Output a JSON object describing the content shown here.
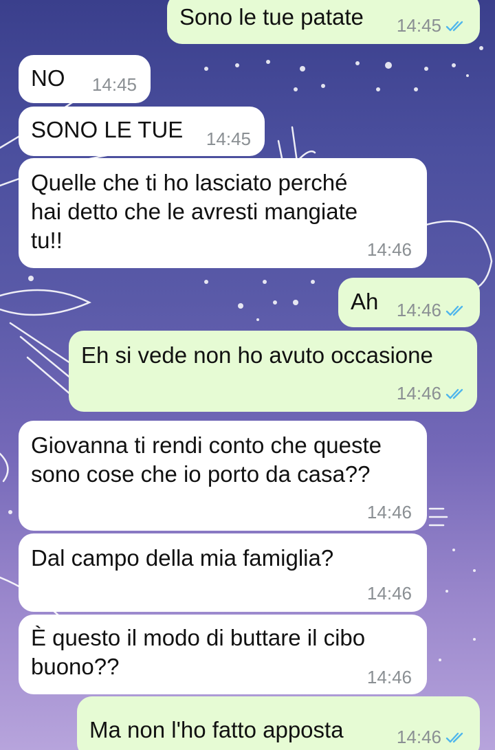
{
  "chat": {
    "messages": [
      {
        "direction": "out",
        "text": "Sono le tue patate",
        "time": "14:45",
        "status": "read"
      },
      {
        "direction": "in",
        "text": "NO",
        "time": "14:45"
      },
      {
        "direction": "in",
        "text": "SONO LE TUE",
        "time": "14:45"
      },
      {
        "direction": "in",
        "text": "Quelle che ti ho lasciato perché\nhai detto che le avresti mangiate\ntu!!",
        "time": "14:46"
      },
      {
        "direction": "out",
        "text": "Ah",
        "time": "14:46",
        "status": "read"
      },
      {
        "direction": "out",
        "text": "Eh si vede non ho avuto occasione",
        "time": "14:46",
        "status": "read"
      },
      {
        "direction": "in",
        "text": "Giovanna ti rendi conto che queste\nsono cose che io porto da casa??",
        "time": "14:46"
      },
      {
        "direction": "in",
        "text": "Dal campo della mia famiglia?",
        "time": "14:46"
      },
      {
        "direction": "in",
        "text": "È questo il modo di buttare il cibo\nbuono??",
        "time": "14:46"
      },
      {
        "direction": "out",
        "text": "Ma non l'ho fatto apposta",
        "time": "14:46",
        "status": "read"
      }
    ]
  },
  "colors": {
    "incoming_bubble": "#ffffff",
    "outgoing_bubble": "#e6fbd4",
    "read_tick": "#4fb6ec",
    "timestamp": "#8a8f93"
  },
  "icons": {
    "read_status": "double-check-icon"
  }
}
